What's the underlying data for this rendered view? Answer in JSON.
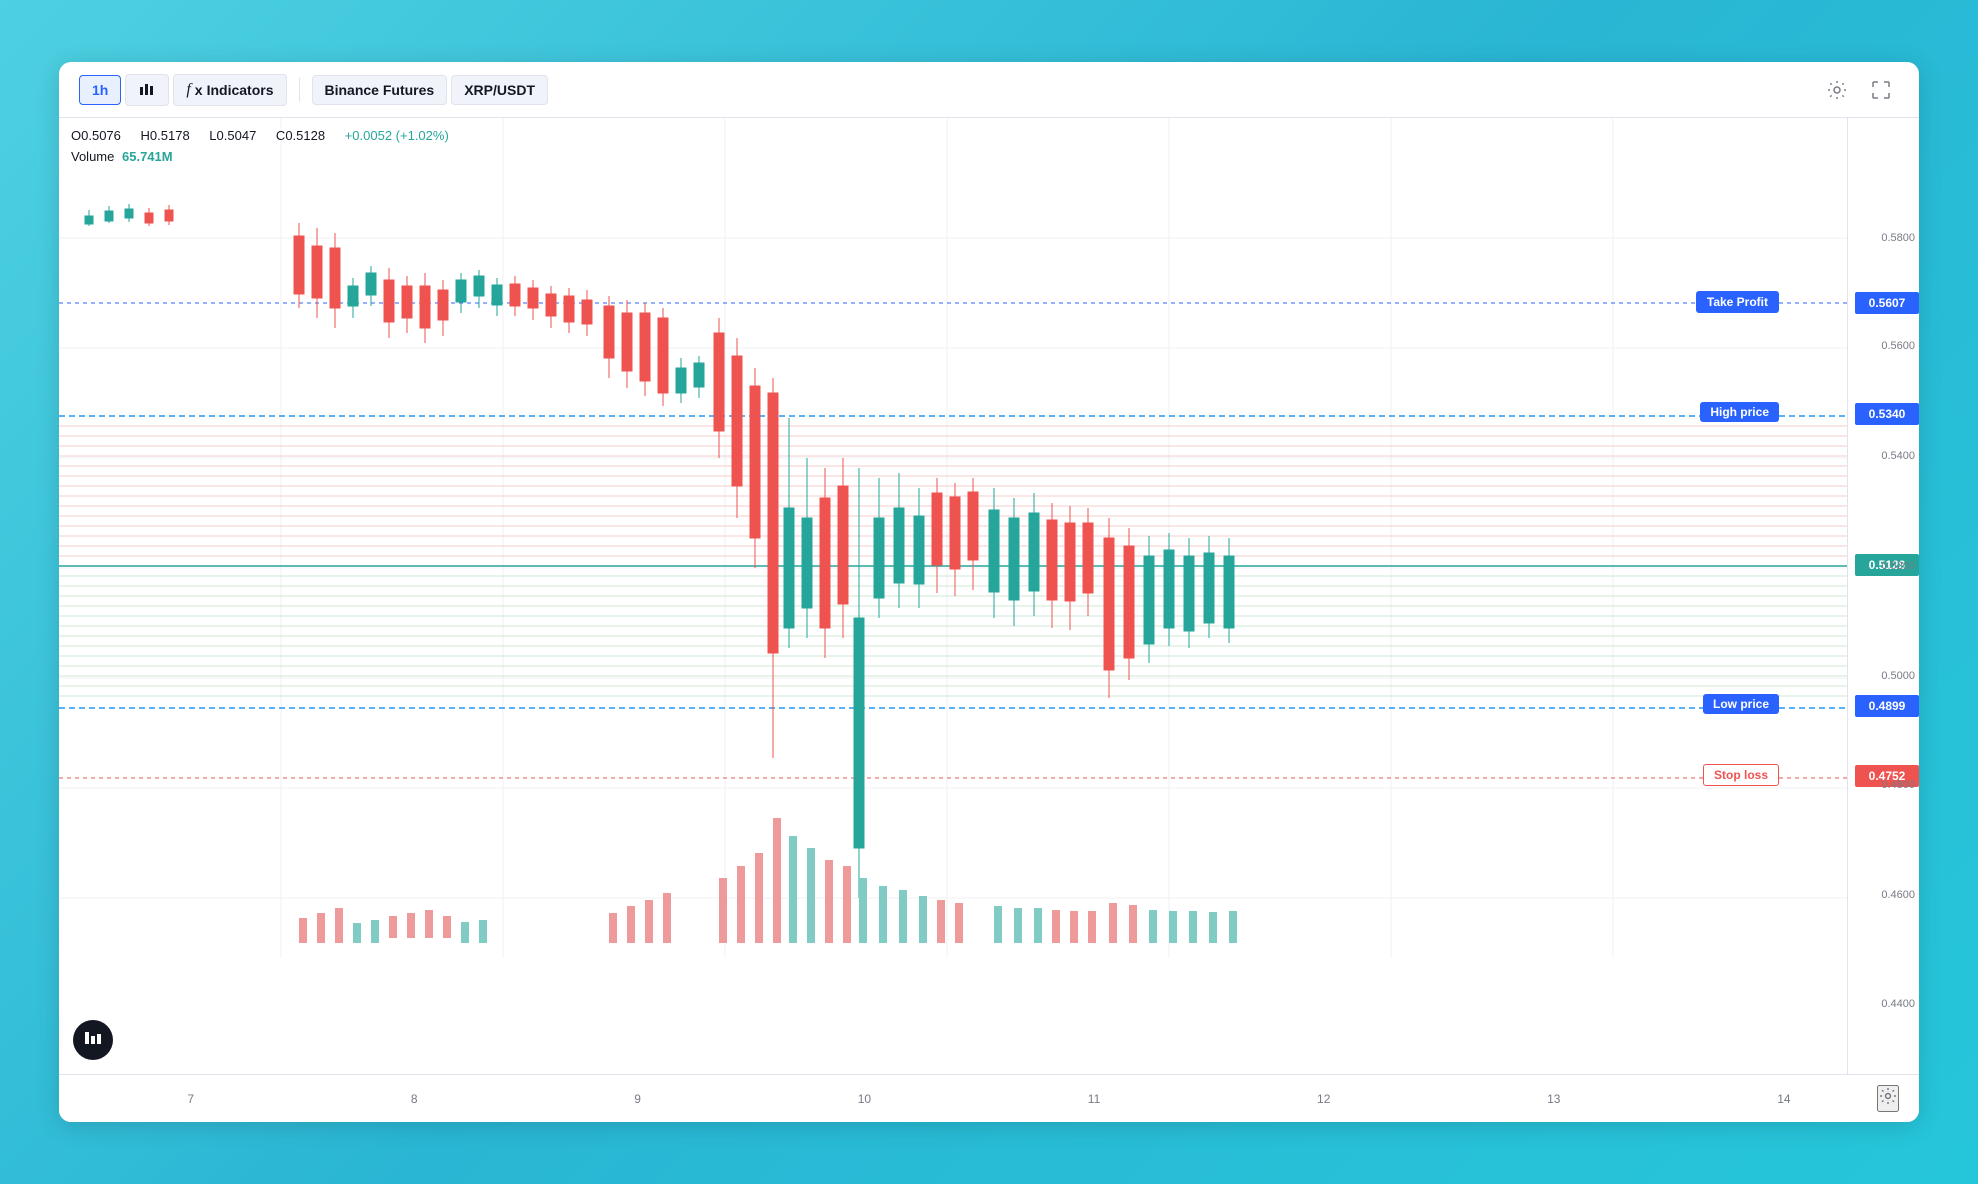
{
  "toolbar": {
    "timeframe": "1h",
    "chart_type_icon": "⧉",
    "indicators_label": "Indicators",
    "exchange": "Binance Futures",
    "pair": "XRP/USDT",
    "settings_icon": "⚙",
    "fullscreen_icon": "⛶"
  },
  "price_info": {
    "open_label": "O",
    "open_val": "0.5076",
    "high_label": "H",
    "high_val": "0.5178",
    "low_label": "L",
    "low_val": "0.5047",
    "close_label": "C",
    "close_val": "0.5128",
    "change": "+0.0052 (+1.02%)",
    "volume_label": "Volume",
    "volume_val": "65.741M"
  },
  "levels": {
    "take_profit": {
      "label": "Take Profit",
      "price": "0.5607",
      "color": "#2962ff"
    },
    "high_price": {
      "label": "High price",
      "price": "0.5340",
      "color": "#2962ff"
    },
    "current": {
      "price": "0.5128",
      "color": "#26a69a"
    },
    "low_price": {
      "label": "Low price",
      "price": "0.4899",
      "color": "#2962ff"
    },
    "stop_loss": {
      "label": "Stop loss",
      "price": "0.4752",
      "color": "#ef5350"
    }
  },
  "y_axis": {
    "prices": [
      "0.5800",
      "0.5600",
      "0.5400",
      "0.5200",
      "0.5000",
      "0.4800",
      "0.4600",
      "0.4400"
    ]
  },
  "x_axis": {
    "labels": [
      "7",
      "8",
      "9",
      "10",
      "11",
      "12",
      "13",
      "14"
    ]
  },
  "colors": {
    "bull": "#26a69a",
    "bear": "#ef5350",
    "take_profit_line": "#2962ff",
    "stop_loss_line": "#ef5350",
    "high_price_line": "#2196f3",
    "low_price_line": "#2196f3",
    "grid_red": "#ffebee",
    "grid_green": "#e8f5e9"
  }
}
